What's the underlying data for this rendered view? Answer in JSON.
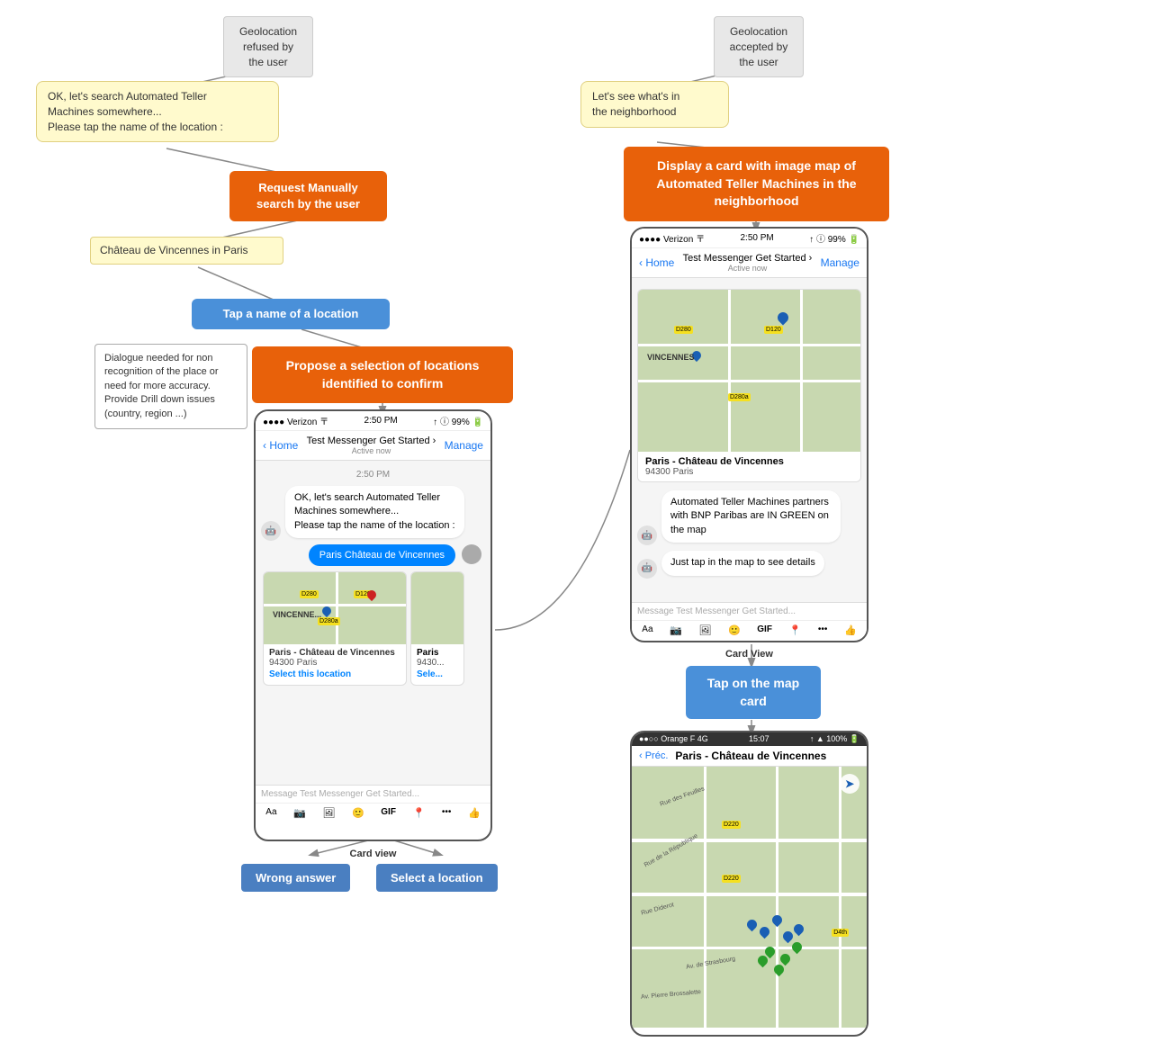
{
  "left_column": {
    "geo_refused_label": "Geolocation\nrefused by\nthe user",
    "speech_bubble_text": "OK, let's search Automated Teller\nMachines somewhere...\nPlease tap the name of the location :",
    "request_manually_label": "Request Manually\nsearch by the user",
    "chateau_label": "Château de Vincennes in Paris",
    "tap_name_label": "Tap a name of a location",
    "dialogue_needed_label": "Dialogue needed for non\nrecognition of the place or\nneed for more accuracy.\nProvide Drill down issues\n(country, region ...)",
    "propose_selection_label": "Propose a selection\nof locations  identified to confirm",
    "phone1": {
      "status": "●●●● Verizon 〒    2:50 PM    ↑ ⓘ 99% 🔋",
      "header_back": "< Home",
      "header_title": "Test Messenger Get Started ›",
      "header_subtitle": "Active now",
      "header_manage": "Manage",
      "chat_time": "2:50 PM",
      "bot_msg1": "OK, let's search Automated Teller\nMachines somewhere...",
      "bot_msg2": "Please tap the name of the location :",
      "user_msg": "Paris Château de Vincennes",
      "card_location_name": "Paris - Château de Vincennes",
      "card_location_zip": "94300 Paris",
      "card_location_name2": "Paris",
      "card_location_zip2": "9430...",
      "select_btn1": "Select this location",
      "select_btn2": "Sele...",
      "input_placeholder": "Message Test Messenger Get Started...",
      "label": "Card view"
    },
    "wrong_answer_btn": "Wrong answer",
    "select_location_btn": "Select a location"
  },
  "right_column": {
    "geo_accepted_label": "Geolocation\naccepted by\nthe user",
    "speech_bubble2_text": "Let's see what's in\nthe neighborhood",
    "display_card_label": "Display a card with image map of\nAutomated Teller Machines in the\nneighborhood",
    "phone2": {
      "status": "●●●● Verizon 〒    2:50 PM    ↑ ⓘ 99% 🔋",
      "header_back": "< Home",
      "header_title": "Test Messenger Get Started ›",
      "header_subtitle": "Active now",
      "header_manage": "Manage",
      "card_location_name": "Paris - Château de Vincennes",
      "card_location_zip": "94300 Paris",
      "bot_msg1": "Automated Teller Machines\npartners with BNP Paribas are\nIN GREEN on the map",
      "bot_msg2": "Just tap in the map to see details",
      "input_placeholder": "Message Test Messenger Get Started...",
      "label": "Card View"
    },
    "tap_map_card_label": "Tap on the\nmap card",
    "phone3": {
      "status": "●●○○ Orange F  4G      15:07     ↑ ▲ 100% 🔋",
      "header_back": "< Préc.",
      "header_title": "Paris - Château de Vincennes"
    }
  },
  "icons": {
    "back_arrow": "‹",
    "bot_avatar": "🤖",
    "aa_icon": "Aa",
    "camera_icon": "📷",
    "gallery_icon": "🖼",
    "emoji_icon": "🙂",
    "gif_icon": "GIF",
    "location_icon": "📍",
    "more_icon": "•••",
    "like_icon": "👍"
  }
}
